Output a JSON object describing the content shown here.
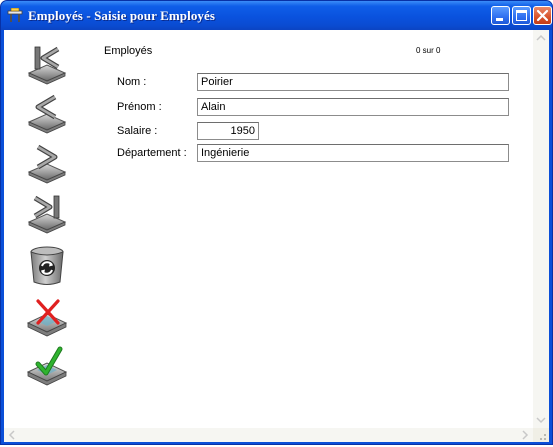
{
  "window": {
    "title": "Employés - Saisie pour  Employés"
  },
  "form": {
    "section_title": "Employés",
    "record_counter": "0 sur 0",
    "fields": {
      "nom": {
        "label": "Nom :",
        "value": "Poirier"
      },
      "prenom": {
        "label": "Prénom :",
        "value": "Alain"
      },
      "salaire": {
        "label": "Salaire :",
        "value": "1950"
      },
      "departement": {
        "label": "Département :",
        "value": "Ingénierie"
      }
    }
  },
  "toolbar": {
    "buttons": [
      "first-record-icon",
      "previous-record-icon",
      "next-record-icon",
      "last-record-icon",
      "refresh-icon",
      "cancel-icon",
      "validate-icon"
    ]
  },
  "colors": {
    "titlebar": "#0a52de",
    "close_button": "#d8532c",
    "cancel_mark": "#e02020",
    "validate_mark": "#2fb32f"
  }
}
